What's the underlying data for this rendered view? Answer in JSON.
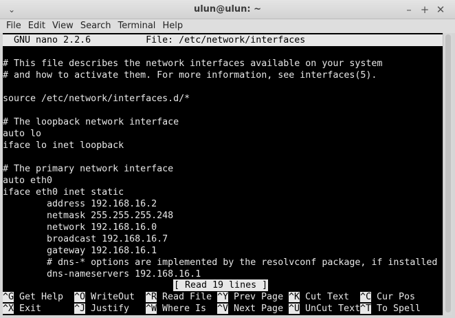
{
  "window": {
    "title": "ulun@ulun: ~",
    "menu_arrow": "⌄",
    "minimize": "–",
    "maximize": "+",
    "close": "✕"
  },
  "menubar": [
    "File",
    "Edit",
    "View",
    "Search",
    "Terminal",
    "Help"
  ],
  "nano": {
    "header": "  GNU nano 2.2.6          File: /etc/network/interfaces",
    "lines": [
      "",
      "# This file describes the network interfaces available on your system",
      "# and how to activate them. For more information, see interfaces(5).",
      "",
      "source /etc/network/interfaces.d/*",
      "",
      "# The loopback network interface",
      "auto lo",
      "iface lo inet loopback",
      "",
      "# The primary network interface",
      "auto eth0",
      "iface eth0 inet static",
      "        address 192.168.16.2",
      "        netmask 255.255.255.248",
      "        network 192.168.16.0",
      "        broadcast 192.168.16.7",
      "        gateway 192.168.16.1",
      "        # dns-* options are implemented by the resolvconf package, if installed",
      "        dns-nameservers 192.168.16.1"
    ],
    "status": "[ Read 19 lines ]",
    "shortcuts_row1": [
      {
        "key": "^G",
        "label": " Get Help"
      },
      {
        "key": "^O",
        "label": " WriteOut"
      },
      {
        "key": "^R",
        "label": " Read File"
      },
      {
        "key": "^Y",
        "label": " Prev Page"
      },
      {
        "key": "^K",
        "label": " Cut Text"
      },
      {
        "key": "^C",
        "label": " Cur Pos"
      }
    ],
    "shortcuts_row2": [
      {
        "key": "^X",
        "label": " Exit"
      },
      {
        "key": "^J",
        "label": " Justify"
      },
      {
        "key": "^W",
        "label": " Where Is"
      },
      {
        "key": "^V",
        "label": " Next Page"
      },
      {
        "key": "^U",
        "label": " UnCut Text"
      },
      {
        "key": "^T",
        "label": " To Spell"
      }
    ]
  }
}
